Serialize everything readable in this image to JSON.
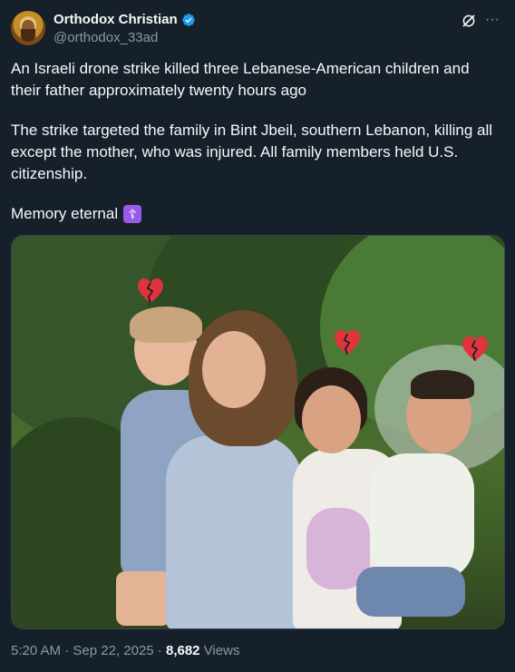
{
  "author": {
    "display_name": "Orthodox Christian",
    "handle": "@orthodox_33ad",
    "verified": true
  },
  "icons": {
    "avatar": "icon-avatar",
    "verified": "verified-badge-icon",
    "grok": "grok-icon",
    "more": "more-icon",
    "cross": "orthodox-cross-icon",
    "hearts": "broken-heart-icon"
  },
  "post": {
    "paragraph1": "An Israeli drone strike killed three Lebanese-American children and their father approximately twenty hours ago",
    "paragraph2": "The strike targeted the family in Bint Jbeil, southern Lebanon, killing all except the mother, who was injured. All family members held U.S. citizenship.",
    "paragraph3": "Memory eternal",
    "cross_glyph": "☦"
  },
  "footer": {
    "time": "5:20 AM",
    "separator1": " · ",
    "date": "Sep 22, 2025",
    "separator2": " · ",
    "views_count": "8,682",
    "views_label": " Views"
  },
  "colors": {
    "background": "#15202b",
    "text": "#f7f9f9",
    "secondary": "#8b98a5",
    "verified": "#1d9bf0",
    "heart": "#e0333d"
  }
}
